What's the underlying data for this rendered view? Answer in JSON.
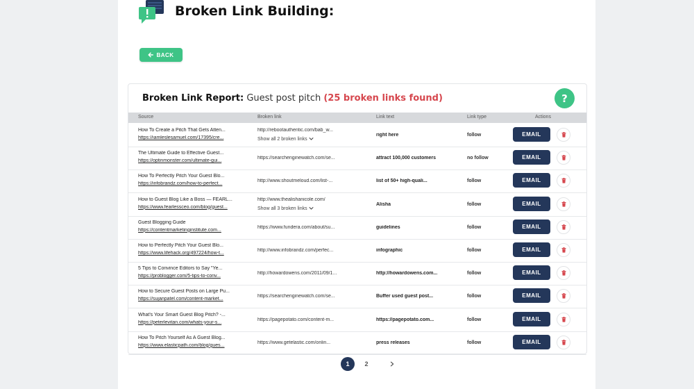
{
  "colors": {
    "accent_green": "#3ec486",
    "navy": "#24375a",
    "alert_red": "#d6474e"
  },
  "header": {
    "title": "Broken Link Building:",
    "logo_icon": "chat-bubbles-icon"
  },
  "back_button": {
    "label": "BACK",
    "icon": "arrow-left-icon"
  },
  "report": {
    "label": "Broken Link Report:",
    "name": "Guest post pitch",
    "count_text": "(25 broken links found)",
    "help_label": "?"
  },
  "table": {
    "headers": [
      "Source",
      "Broken link",
      "Link text",
      "Link type",
      "Actions"
    ],
    "rows": [
      {
        "title": "How To Create a Pitch That Gets Atten...",
        "url": "https://iamleslesamuel.com/17395/cre...",
        "broken": "http://rebootauthentic.com/bab_w...",
        "show_all": "Show all 2 broken links",
        "text": "right here",
        "type": "follow"
      },
      {
        "title": "The Ultimate Guide to Effective Guest...",
        "url": "https://optinmonster.com/ultimate-gui...",
        "broken": "https://searchenginewatch.com/se...",
        "show_all": "",
        "text": "attract 100,000 customers",
        "type": "no follow"
      },
      {
        "title": "How To Perfectly Pitch Your Guest Blo...",
        "url": "https://infobrandz.com/how-to-perfect...",
        "broken": "http://www.shoutmeloud.com/list-...",
        "show_all": "",
        "text": "list of 50+ high-quali...",
        "type": "follow"
      },
      {
        "title": "How to Guest Blog Like a Boss — FEARL...",
        "url": "https://www.fearlessceo.com/blog/guest...",
        "broken": "http://www.thealishanicole.com/",
        "show_all": "Show all 3 broken links",
        "text": "Alisha",
        "type": "follow"
      },
      {
        "title": "Guest Blogging Guide",
        "url": "https://contentmarketinginstitute.com...",
        "broken": "https://www.fundera.com/about/su...",
        "show_all": "",
        "text": "guidelines",
        "type": "follow"
      },
      {
        "title": "How to Perfectly Pitch Your Guest Blo...",
        "url": "https://www.lifehack.org/497224/how-t...",
        "broken": "http://www.infobrandz.com/perfec...",
        "show_all": "",
        "text": "infographic",
        "type": "follow"
      },
      {
        "title": "5 Tips to Convince Editors to Say \"Ye...",
        "url": "https://problogger.com/5-tips-to-conv...",
        "broken": "http://howardowens.com/2011/09/1...",
        "show_all": "",
        "text": "http://howardowens.com...",
        "type": "follow"
      },
      {
        "title": "How to Secure Guest Posts on Large Pu...",
        "url": "https://sujanpatel.com/content-market...",
        "broken": "https://searchenginewatch.com/se...",
        "show_all": "",
        "text": "Buffer used guest post...",
        "type": "follow"
      },
      {
        "title": "What's Your Smart Guest Blog Pitch? -...",
        "url": "https://peterlevitan.com/whats-your-s...",
        "broken": "https://pagepotato.com/content-m...",
        "show_all": "",
        "text": "https://pagepotato.com...",
        "type": "follow"
      },
      {
        "title": "How To Pitch Yourself As A Guest Blog...",
        "url": "https://www.elasticpath.com/blog/gues...",
        "broken": "https://www.getelastic.com/onlin...",
        "show_all": "",
        "text": "press releases",
        "type": "follow"
      }
    ],
    "email_label": "EMAIL",
    "delete_icon": "trash-icon"
  },
  "pagination": {
    "pages": [
      "1",
      "2"
    ],
    "current": "1",
    "next_icon": "chevron-right-icon"
  }
}
